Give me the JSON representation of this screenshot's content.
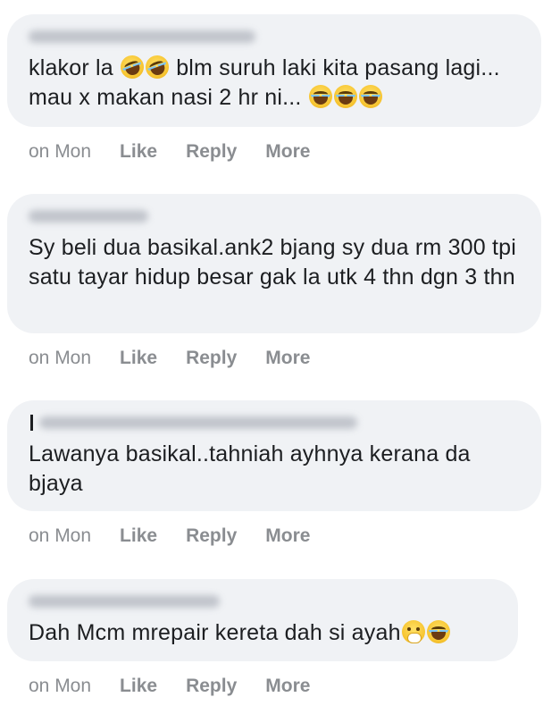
{
  "comments": [
    {
      "author_hidden": true,
      "text_before": "klakor la ",
      "text_mid": " blm suruh laki kita pasang lagi... mau x makan nasi 2 hr ni... ",
      "time": "on Mon",
      "like": "Like",
      "reply": "Reply",
      "more": "More"
    },
    {
      "author_hidden": true,
      "text": "Sy beli dua basikal.ank2 bjang sy dua rm 300 tpi satu tayar hidup besar gak la utk 4 thn dgn 3 thn",
      "time": "on Mon",
      "like": "Like",
      "reply": "Reply",
      "more": "More"
    },
    {
      "author_hidden": true,
      "text": "Lawanya basikal..tahniah ayhnya kerana da bjaya",
      "time": "on Mon",
      "like": "Like",
      "reply": "Reply",
      "more": "More"
    },
    {
      "author_hidden": true,
      "text": "Dah Mcm mrepair kereta dah si ayah",
      "time": "on Mon",
      "like": "Like",
      "reply": "Reply",
      "more": "More"
    }
  ],
  "icons": {
    "laugh": "face-with-tears-of-joy-icon",
    "rofl": "rolling-on-floor-laughing-icon",
    "shh": "face-with-hand-over-mouth-icon"
  },
  "colors": {
    "bubble": "#f0f2f5",
    "text": "#1c1e21",
    "meta": "#8a8d91"
  }
}
